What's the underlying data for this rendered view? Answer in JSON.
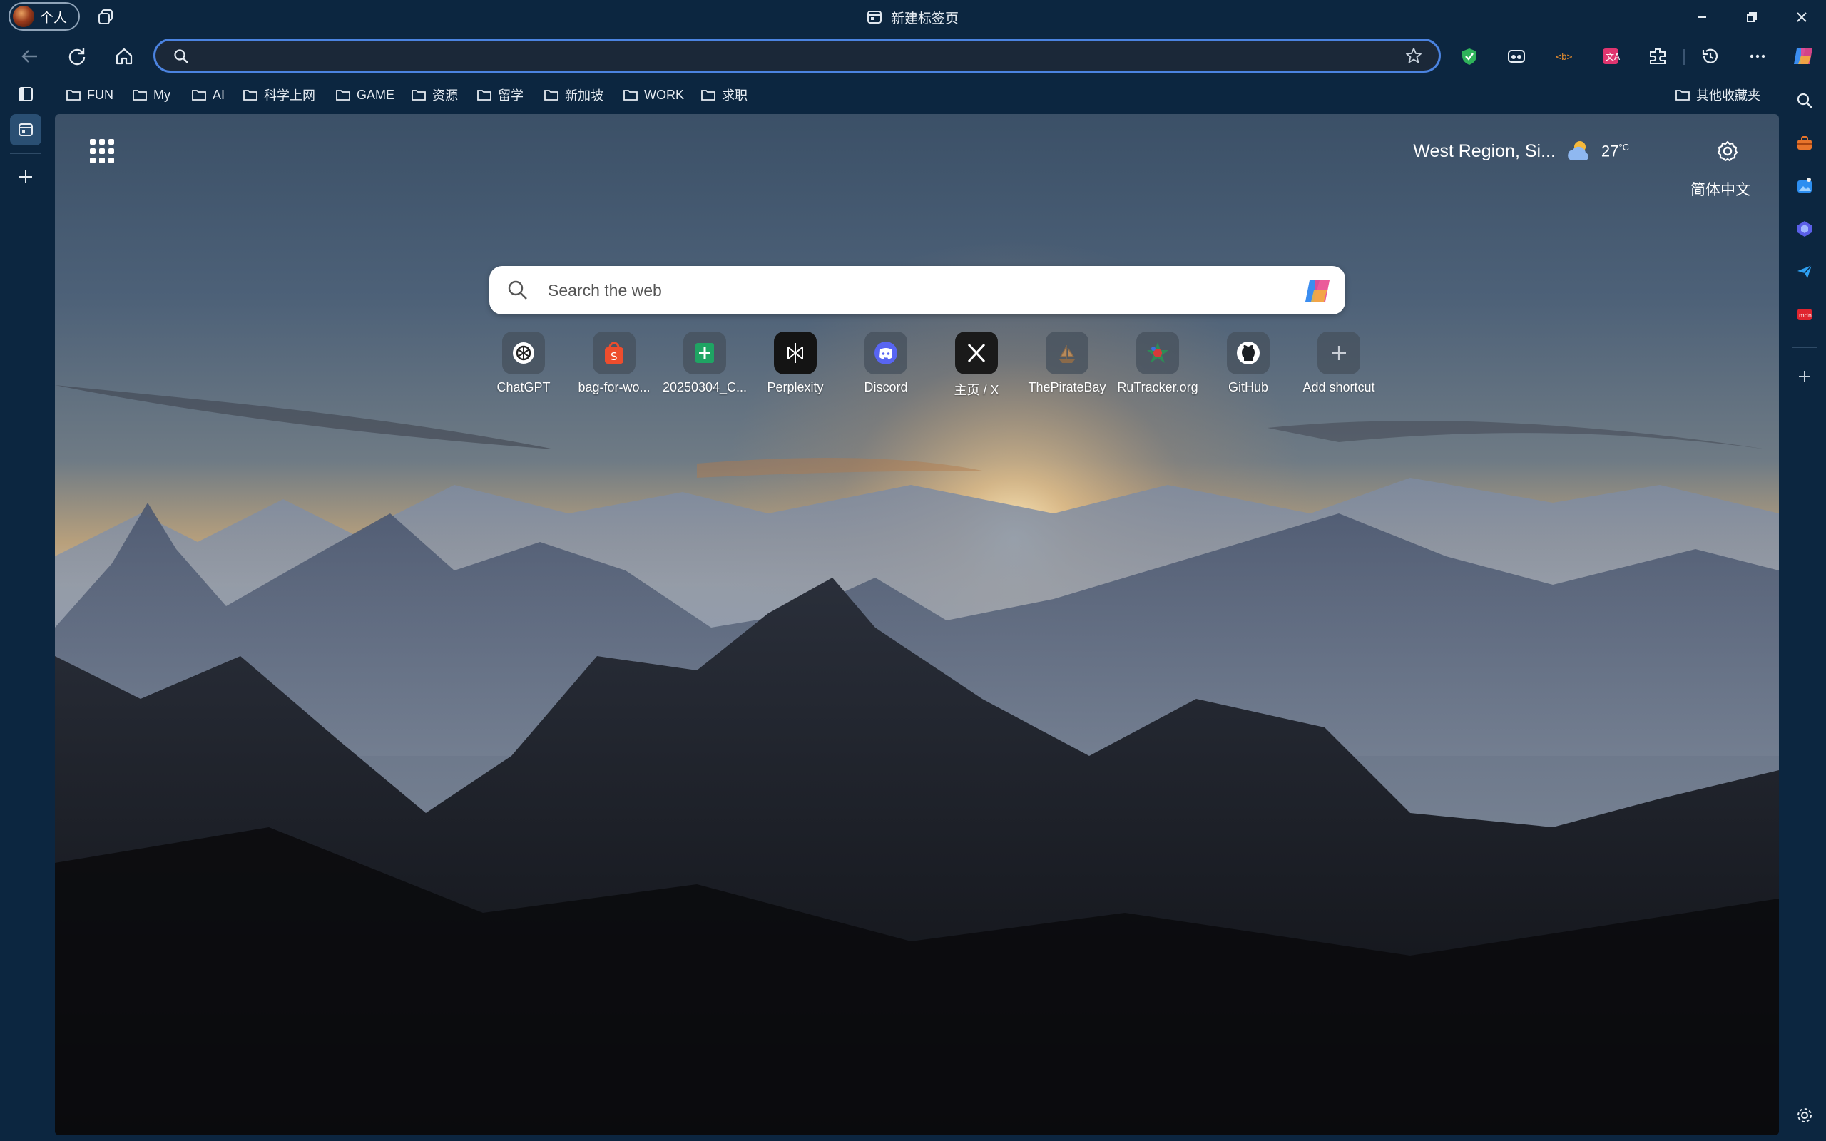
{
  "titlebar": {
    "profile_label": "个人",
    "window_title": "新建标签页"
  },
  "addressbar": {
    "value": "",
    "placeholder": ""
  },
  "bookmarks": [
    {
      "label": "FUN"
    },
    {
      "label": "My"
    },
    {
      "label": "AI"
    },
    {
      "label": "科学上网"
    },
    {
      "label": "GAME"
    },
    {
      "label": "资源"
    },
    {
      "label": "留学"
    },
    {
      "label": "新加坡"
    },
    {
      "label": "WORK"
    },
    {
      "label": "求职"
    }
  ],
  "other_bookmarks": "其他收藏夹",
  "newtab": {
    "weather": {
      "location": "West Region, Si...",
      "temp": "27",
      "unit": "°C"
    },
    "language": "简体中文",
    "search": {
      "placeholder": "Search the web"
    },
    "shortcuts": [
      {
        "label": "ChatGPT",
        "icon": "chatgpt-icon"
      },
      {
        "label": "bag-for-wo...",
        "icon": "shopee-icon"
      },
      {
        "label": "20250304_C...",
        "icon": "sheets-icon"
      },
      {
        "label": "Perplexity",
        "icon": "perplexity-icon"
      },
      {
        "label": "Discord",
        "icon": "discord-icon"
      },
      {
        "label": "主页 / X",
        "icon": "x-icon"
      },
      {
        "label": "ThePirateBay",
        "icon": "piratebay-icon"
      },
      {
        "label": "RuTracker.org",
        "icon": "rutracker-icon"
      },
      {
        "label": "GitHub",
        "icon": "github-icon"
      },
      {
        "label": "Add shortcut",
        "icon": "plus-icon"
      }
    ]
  },
  "colors": {
    "accent": "#4b83e0",
    "chrome": "#0c2640"
  }
}
